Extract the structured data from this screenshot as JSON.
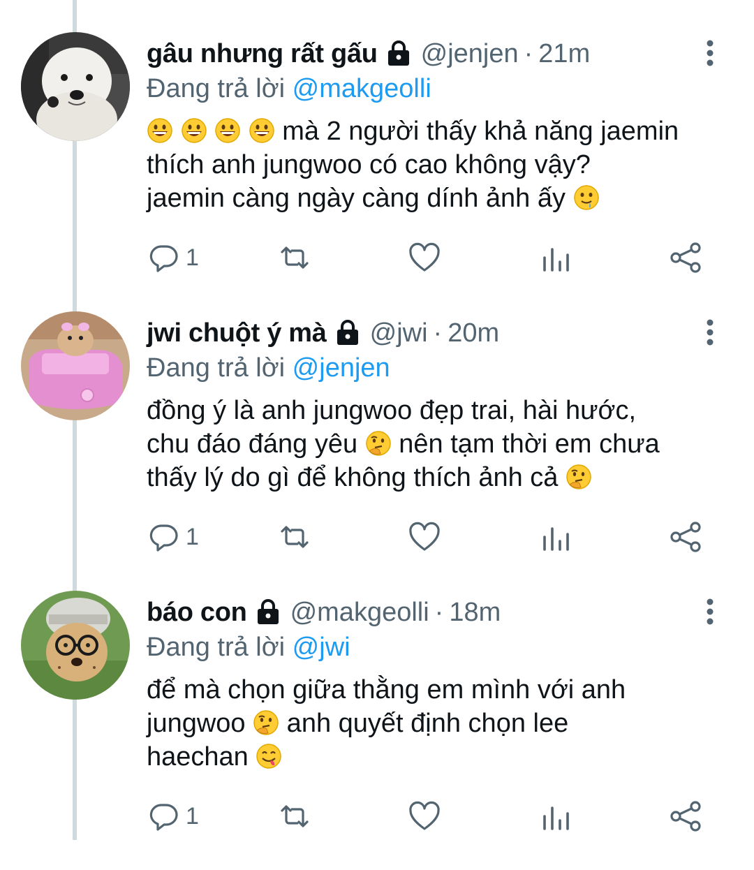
{
  "tweets": [
    {
      "name": "gâu nhưng rất gấu",
      "handle": "@jenjen",
      "separator": "·",
      "time": "21m",
      "replying_label": "Đang trả lời",
      "replying_to": "@makgeolli",
      "lines": [
        {
          "emojis_before": [
            "grinning-face",
            "grinning-face",
            "grinning-face",
            "grinning-face"
          ],
          "text": " mà 2 người thấy khả năng jaemin",
          "emoji_after": null
        },
        {
          "emojis_before": [],
          "text": "thích anh jungwoo có cao không vậy?",
          "emoji_after": null
        },
        {
          "emojis_before": [],
          "text": "jaemin càng ngày càng dính ảnh ấy ",
          "emoji_after": "drooling-face"
        }
      ],
      "reply_count": "1"
    },
    {
      "name": "jwi chuột ý mà",
      "handle": "@jwi",
      "separator": "·",
      "time": "20m",
      "replying_label": "Đang trả lời",
      "replying_to": "@jenjen",
      "lines": [
        {
          "emojis_before": [],
          "text": "đồng ý là anh jungwoo đẹp trai, hài hước,",
          "emoji_after": null
        },
        {
          "emojis_before": [],
          "text": "chu đáo đáng yêu ",
          "emoji_after": "thinking-face",
          "text_after": " nên tạm thời em chưa"
        },
        {
          "emojis_before": [],
          "text": "thấy lý do gì để không thích ảnh cả ",
          "emoji_after": "thinking-face"
        }
      ],
      "reply_count": "1"
    },
    {
      "name": "báo con",
      "handle": "@makgeolli",
      "separator": "·",
      "time": "18m",
      "replying_label": "Đang trả lời",
      "replying_to": "@jwi",
      "lines": [
        {
          "emojis_before": [],
          "text": "để mà chọn giữa thằng em mình với anh",
          "emoji_after": null
        },
        {
          "emojis_before": [],
          "text": "jungwoo ",
          "emoji_after": "thinking-face",
          "text_after": " anh quyết định chọn lee"
        },
        {
          "emojis_before": [],
          "text": "haechan ",
          "emoji_after": "yum-face"
        }
      ],
      "reply_count": "1"
    }
  ],
  "icons": {
    "reply": "reply-icon",
    "retweet": "retweet-icon",
    "like": "heart-icon",
    "analytics": "analytics-icon",
    "share": "share-icon",
    "more": "more-vertical-icon",
    "lock": "lock-icon"
  },
  "colors": {
    "accent": "#1d9bf0",
    "secondary_text": "#536471",
    "thread_line": "#cfd9de"
  }
}
